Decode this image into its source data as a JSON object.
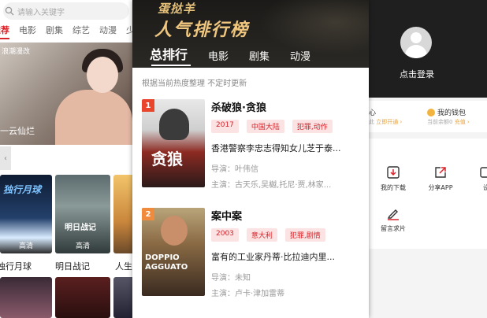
{
  "home": {
    "search_placeholder": "请输入关键字",
    "categories": [
      "推荐",
      "电影",
      "剧集",
      "综艺",
      "动漫",
      "少"
    ],
    "banner_top": "浪潮漫改",
    "banner_caption": "一云仙烂",
    "poster_badge": "高清",
    "poster_art_text": [
      "独行月球",
      "明日战记"
    ],
    "titles": [
      "独行月球",
      "明日战记",
      "人生大"
    ]
  },
  "ranking": {
    "brand": "蛋挞羊",
    "title": "人气排行榜",
    "tabs": [
      "总排行",
      "电影",
      "剧集",
      "动漫"
    ],
    "subtitle": "根据当前热度整理 不定时更新",
    "items": [
      {
        "rank": "1",
        "name": "杀破狼·贪狼",
        "tags": [
          "2017",
          "中国大陆",
          "犯罪,动作"
        ],
        "desc": "香港警察李忠志得知女儿芝于泰...",
        "director": "导演：叶伟信",
        "cast": "主演：古天乐,吴樾,托尼·贾,林家...",
        "cover_text": "贪狼",
        "rank_color": "#e8452c"
      },
      {
        "rank": "2",
        "name": "案中案",
        "tags": [
          "2003",
          "意大利",
          "犯罪,剧情"
        ],
        "desc": "富有的工业家丹蒂·比拉迪内里...",
        "director": "导演：未知",
        "cast": "主演：卢卡·津加雷蒂",
        "cover_text": "DOPPIO AGGUATO",
        "rank_color": "#f08a3c"
      }
    ]
  },
  "profile": {
    "login": "点击登录",
    "vip_title": "心",
    "vip_sub_prefix": "此",
    "vip_sub_link": "立即开通 ›",
    "wallet_title": "我的钱包",
    "wallet_sub_prefix": "当前余额0",
    "wallet_sub_link": "充值 ›",
    "menu": [
      "我的下载",
      "分享APP",
      "留言求片",
      "设"
    ]
  },
  "colors": {
    "accent_red": "#d8232a",
    "gold": "#f0c77f",
    "hero_bg": "#1b1a18"
  }
}
